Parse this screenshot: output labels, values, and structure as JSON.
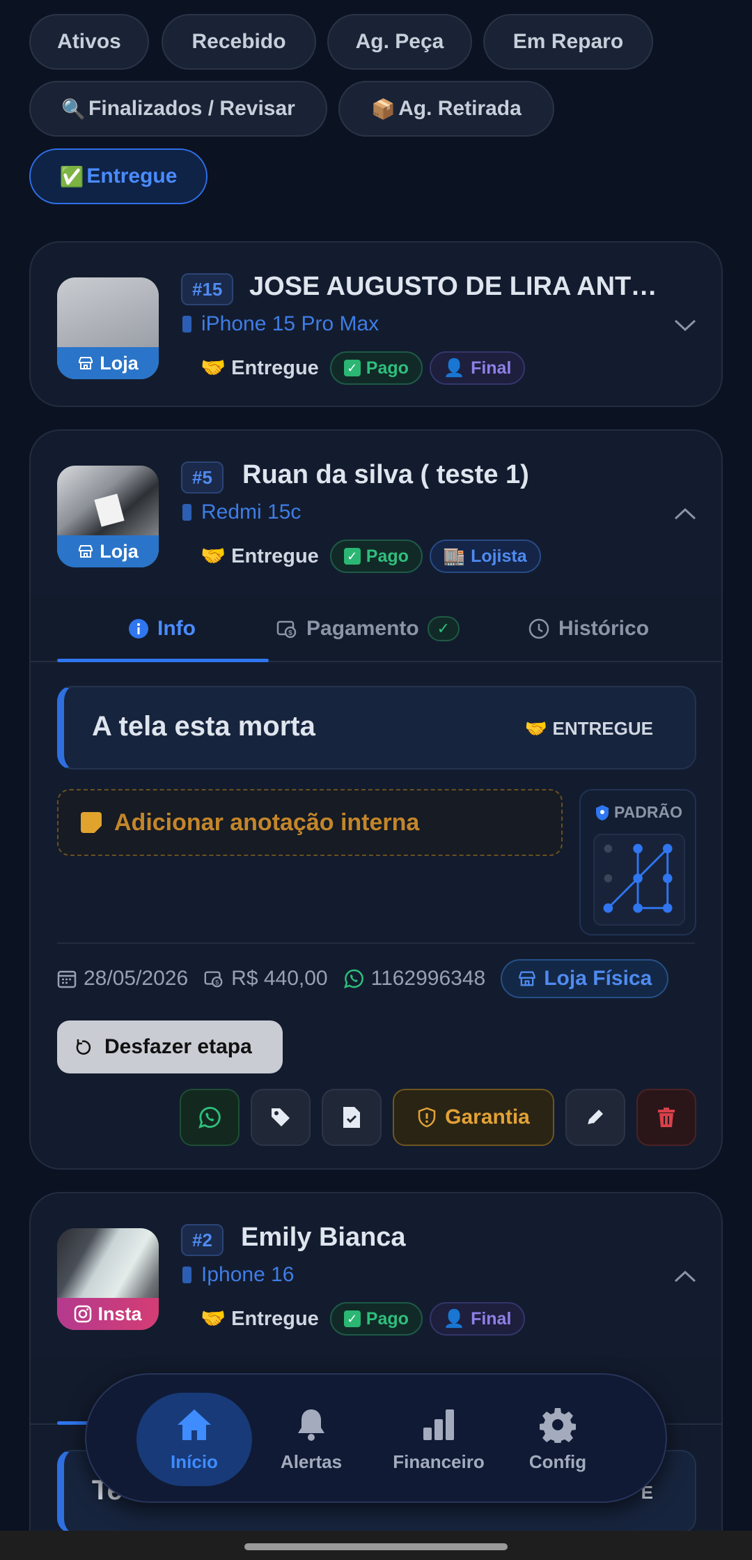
{
  "filters": [
    {
      "label": "Ativos",
      "emoji": ""
    },
    {
      "label": "Recebido",
      "emoji": ""
    },
    {
      "label": "Ag. Peça",
      "emoji": ""
    },
    {
      "label": "Em Reparo",
      "emoji": ""
    },
    {
      "label": "Finalizados / Revisar",
      "emoji": "🔍"
    },
    {
      "label": "Ag. Retirada",
      "emoji": "📦"
    },
    {
      "label": "Entregue",
      "emoji": "✅"
    }
  ],
  "cards": [
    {
      "id": "#15",
      "name": "JOSE AUGUSTO DE LIRA ANTO...",
      "model": "iPhone 15 Pro Max",
      "source": "Loja",
      "status": "Entregue",
      "status_emoji": "🤝",
      "payment": "Pago",
      "type": "Final",
      "type_emoji": "👤"
    },
    {
      "id": "#5",
      "name": "Ruan da silva ( teste 1)",
      "model": "Redmi 15c",
      "source": "Loja",
      "status": "Entregue",
      "status_emoji": "🤝",
      "payment": "Pago",
      "type": "Lojista",
      "type_emoji": "🏬"
    },
    {
      "id": "#2",
      "name": "Emily Bianca",
      "model": "Iphone 16",
      "source": "Insta",
      "status": "Entregue",
      "status_emoji": "🤝",
      "payment": "Pago",
      "type": "Final",
      "type_emoji": "👤"
    }
  ],
  "detail": {
    "tabs": [
      "Info",
      "Pagamento",
      "Histórico"
    ],
    "problem": "A tela esta morta",
    "problem_status": "ENTREGUE",
    "note_placeholder": "Adicionar anotação interna",
    "pattern_label": "PADRÃO",
    "date": "28/05/2026",
    "price": "R$ 440,00",
    "phone": "1162996348",
    "location": "Loja Física",
    "undo_label": "Desfazer etapa",
    "warranty_label": "Garantia"
  },
  "partial": {
    "problem_fragment": "Te",
    "status_fragment": "E"
  },
  "nav": [
    {
      "label": "Início",
      "icon": "home-icon"
    },
    {
      "label": "Alertas",
      "icon": "bell-icon"
    },
    {
      "label": "Financeiro",
      "icon": "bar-chart-icon"
    },
    {
      "label": "Config",
      "icon": "gear-icon"
    }
  ],
  "colors": {
    "background": "#0b1221",
    "accent": "#2f76f0",
    "paid": "#2fbf7d",
    "warranty": "#e3a236",
    "delete": "#d9404a"
  }
}
